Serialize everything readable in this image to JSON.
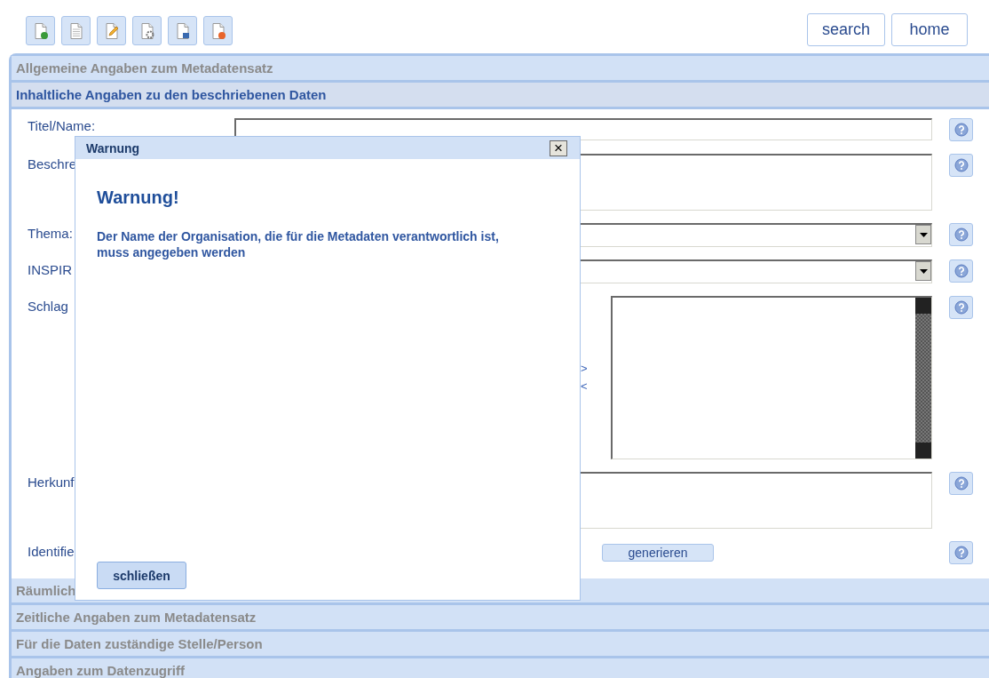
{
  "nav_buttons": [
    "search",
    "home"
  ],
  "sections": [
    {
      "title": "Allgemeine Angaben zum Metadatensatz",
      "expanded": false
    },
    {
      "title": "Inhaltliche Angaben zu den beschriebenen Daten",
      "expanded": true
    },
    {
      "title": "Räumlich",
      "expanded": false
    },
    {
      "title": "Zeitliche Angaben zum Metadatensatz",
      "expanded": false
    },
    {
      "title": "Für die Daten zuständige Stelle/Person",
      "expanded": false
    },
    {
      "title": "Angaben zum Datenzugriff",
      "expanded": false
    }
  ],
  "form": [
    {
      "kind": "text",
      "label": "Titel/Name:"
    },
    {
      "kind": "textarea",
      "label": "Beschre"
    },
    {
      "kind": "select",
      "label": "Thema:"
    },
    {
      "kind": "select",
      "label": "INSPIR"
    },
    {
      "kind": "dual_list",
      "label": "Schlag",
      "add": ">",
      "remove": "<"
    },
    {
      "kind": "textarea",
      "label": "Herkunf"
    },
    {
      "kind": "text_button",
      "label": "Identifie",
      "button": "generieren"
    }
  ],
  "dialog": {
    "title": "Warnung",
    "close": "×",
    "heading": "Warnung!",
    "message": "Der Name der Organisation, die für die Metadaten verantwortlich ist, muss angegeben werden",
    "button": "schließen"
  }
}
